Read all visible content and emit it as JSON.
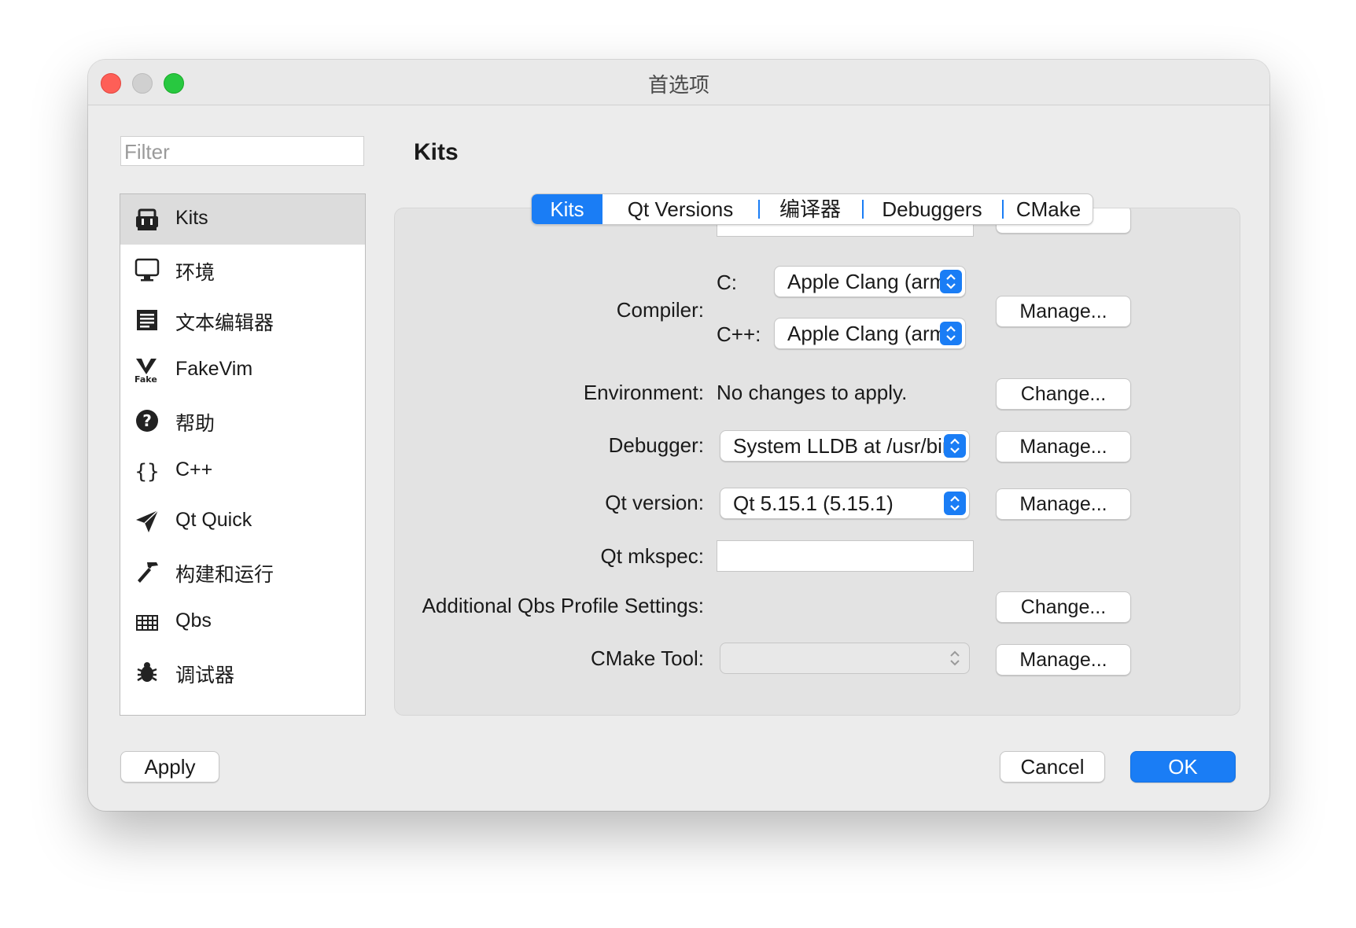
{
  "window": {
    "title": "首选项"
  },
  "filter": {
    "placeholder": "Filter"
  },
  "sidebar": {
    "items": [
      {
        "label": "Kits",
        "icon": "kits-icon",
        "selected": true
      },
      {
        "label": "环境",
        "icon": "monitor-icon"
      },
      {
        "label": "文本编辑器",
        "icon": "text-editor-icon"
      },
      {
        "label": "FakeVim",
        "icon": "fakevim-icon"
      },
      {
        "label": "帮助",
        "icon": "help-icon"
      },
      {
        "label": "C++",
        "icon": "braces-icon"
      },
      {
        "label": "Qt Quick",
        "icon": "paper-plane-icon"
      },
      {
        "label": "构建和运行",
        "icon": "hammer-icon"
      },
      {
        "label": "Qbs",
        "icon": "qbs-icon"
      },
      {
        "label": "调试器",
        "icon": "bug-icon"
      }
    ]
  },
  "page": {
    "title": "Kits"
  },
  "tabs": [
    {
      "label": "Kits",
      "active": true
    },
    {
      "label": "Qt Versions"
    },
    {
      "label": "编译器"
    },
    {
      "label": "Debuggers"
    },
    {
      "label": "CMake"
    }
  ],
  "form": {
    "compiler": {
      "label": "Compiler:",
      "c_label": "C:",
      "c_value": "Apple Clang (arm",
      "cpp_label": "C++:",
      "cpp_value": "Apple Clang (arm",
      "button": "Manage..."
    },
    "environment": {
      "label": "Environment:",
      "value": "No changes to apply.",
      "button": "Change..."
    },
    "debugger": {
      "label": "Debugger:",
      "value": "System LLDB at /usr/bin/",
      "button": "Manage..."
    },
    "qt_version": {
      "label": "Qt version:",
      "value": "Qt 5.15.1 (5.15.1)",
      "button": "Manage..."
    },
    "qt_mkspec": {
      "label": "Qt mkspec:",
      "value": ""
    },
    "qbs_profile": {
      "label": "Additional Qbs Profile Settings:",
      "button": "Change..."
    },
    "cmake_tool": {
      "label": "CMake Tool:",
      "value": "",
      "button": "Manage..."
    }
  },
  "footer": {
    "apply": "Apply",
    "cancel": "Cancel",
    "ok": "OK"
  },
  "colors": {
    "accent": "#1a7df5",
    "close": "#fe5f57",
    "maximize": "#28c840"
  }
}
